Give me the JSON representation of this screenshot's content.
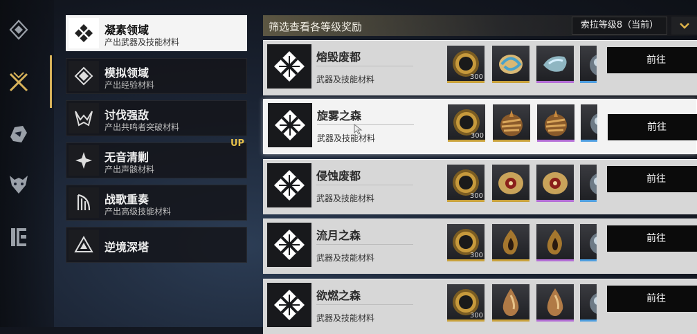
{
  "rail": {
    "icons": [
      "diamond-crystal-icon",
      "crossed-swords-icon",
      "hand-gesture-icon",
      "demon-head-icon",
      "archive-door-icon"
    ],
    "active_index": 1
  },
  "categories": [
    {
      "title": "凝素领域",
      "subtitle": "产出武器及技能材料",
      "icon": "knot-emblem-icon",
      "active": true
    },
    {
      "title": "模拟领域",
      "subtitle": "产出经验材料",
      "icon": "tile-emblem-icon",
      "active": false
    },
    {
      "title": "讨伐强敌",
      "subtitle": "产出共鸣者突破材料",
      "icon": "horn-emblem-icon",
      "active": false
    },
    {
      "title": "无音清剿",
      "subtitle": "产出声骸材料",
      "icon": "spark-emblem-icon",
      "active": false
    },
    {
      "title": "战歌重奏",
      "subtitle": "产出高级技能材料",
      "icon": "harp-emblem-icon",
      "active": false
    },
    {
      "title": "逆境深塔",
      "subtitle": "",
      "icon": "tower-triangle-icon",
      "active": false
    }
  ],
  "up_badge": "UP",
  "header": {
    "title": "筛选查看各等级奖励",
    "level_select": "索拉等级8（当前）"
  },
  "goto_label": "前往",
  "rows": [
    {
      "name": "熔毁废都",
      "type": "武器及技能材料",
      "selected": false,
      "items": [
        {
          "kind": "gear",
          "count": "300",
          "rarity": "gold"
        },
        {
          "kind": "swirl",
          "rarity": "gold"
        },
        {
          "kind": "crystal",
          "rarity": "purple"
        },
        {
          "kind": "orb",
          "rarity": "blue"
        }
      ]
    },
    {
      "name": "旋雾之森",
      "type": "武器及技能材料",
      "selected": true,
      "items": [
        {
          "kind": "gear",
          "count": "300",
          "rarity": "gold"
        },
        {
          "kind": "spiral",
          "rarity": "gold"
        },
        {
          "kind": "spiral",
          "rarity": "purple"
        },
        {
          "kind": "orb",
          "rarity": "blue"
        }
      ]
    },
    {
      "name": "侵蚀废都",
      "type": "武器及技能材料",
      "selected": false,
      "items": [
        {
          "kind": "gear",
          "count": "300",
          "rarity": "gold"
        },
        {
          "kind": "eye",
          "rarity": "gold"
        },
        {
          "kind": "eye",
          "rarity": "purple"
        },
        {
          "kind": "orb",
          "rarity": "blue"
        }
      ]
    },
    {
      "name": "流月之森",
      "type": "武器及技能材料",
      "selected": false,
      "items": [
        {
          "kind": "gear",
          "count": "300",
          "rarity": "gold"
        },
        {
          "kind": "flame",
          "rarity": "gold"
        },
        {
          "kind": "flame",
          "rarity": "purple"
        },
        {
          "kind": "orb",
          "rarity": "blue"
        }
      ]
    },
    {
      "name": "欲燃之森",
      "type": "武器及技能材料",
      "selected": false,
      "items": [
        {
          "kind": "gear",
          "count": "300",
          "rarity": "gold"
        },
        {
          "kind": "drop",
          "rarity": "gold"
        },
        {
          "kind": "drop",
          "rarity": "purple"
        },
        {
          "kind": "orb",
          "rarity": "blue"
        }
      ]
    }
  ],
  "colors": {
    "accent_gold": "#c9a23c",
    "rarity_purple": "#b46ed6",
    "rarity_blue": "#4f9fe0"
  }
}
